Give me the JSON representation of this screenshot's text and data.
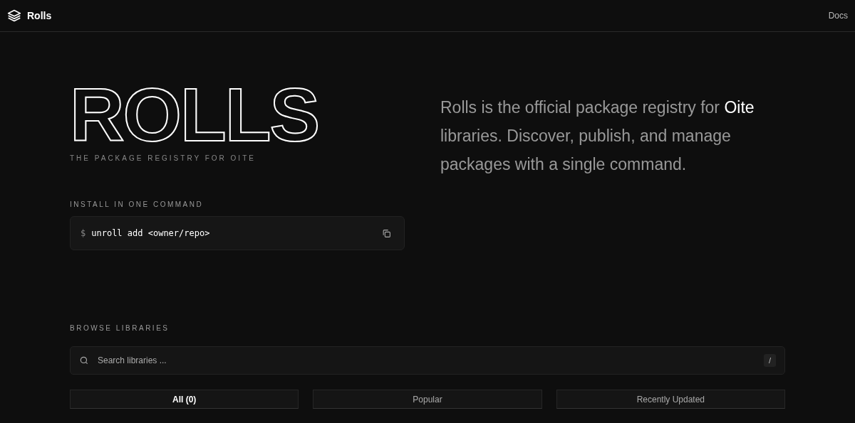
{
  "header": {
    "brand": "Rolls",
    "nav": [
      "Docs"
    ]
  },
  "hero": {
    "title": "ROLLS",
    "subtitle": "THE PACKAGE REGISTRY FOR OITE",
    "description": "Rolls is the official package registry for **Oite** libraries. Discover, publish, and manage packages with a single command."
  },
  "install": {
    "label": "INSTALL IN ONE COMMAND",
    "prompt": "$",
    "command": "unroll add <owner/repo>"
  },
  "browse": {
    "label": "BROWSE LIBRARIES",
    "search": {
      "placeholder": "Search libraries ...",
      "shortcut": "/"
    },
    "tabs": [
      {
        "label": "All (0)",
        "selected": true
      },
      {
        "label": "Popular",
        "selected": false
      },
      {
        "label": "Recently Updated",
        "selected": false
      }
    ]
  }
}
